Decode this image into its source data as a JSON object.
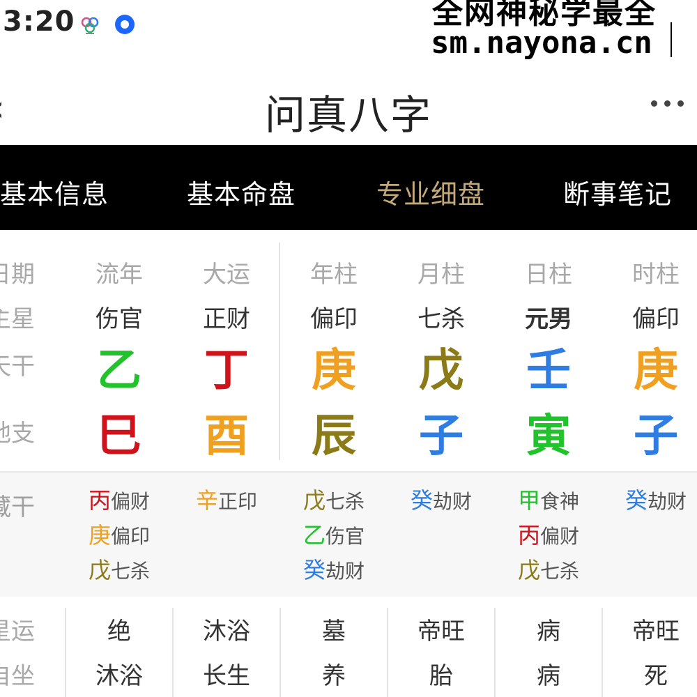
{
  "status_bar": {
    "time": "3:20"
  },
  "watermark": {
    "line1": "全网神秘学最全",
    "line2": "sm.nayona.cn"
  },
  "header": {
    "title": "问真八字"
  },
  "tabs": [
    {
      "label": "基本信息",
      "active": false
    },
    {
      "label": "基本命盘",
      "active": false
    },
    {
      "label": "专业细盘",
      "active": true
    },
    {
      "label": "断事笔记",
      "active": false
    }
  ],
  "row_labels": {
    "date": "日期",
    "main_star": "主星",
    "heavenly_stem": "天干",
    "earthly_branch": "地支",
    "hidden_stem": "藏干",
    "star_fortune": "星运",
    "self_seat": "自坐"
  },
  "columns": [
    {
      "header": "流年",
      "god": "伤官",
      "stem": "乙",
      "stem_color": "#22c22c",
      "branch": "巳",
      "branch_color": "#d0121b",
      "hidden": [
        {
          "stem": "丙",
          "color": "#d0121b",
          "god": "偏财"
        },
        {
          "stem": "庚",
          "color": "#f0a020",
          "god": "偏印"
        },
        {
          "stem": "戊",
          "color": "#8a7a18",
          "god": "七杀"
        }
      ],
      "star_fortune": "绝",
      "self_seat": "沐浴"
    },
    {
      "header": "大运",
      "god": "正财",
      "stem": "丁",
      "stem_color": "#d0121b",
      "branch": "酉",
      "branch_color": "#f0a020",
      "hidden": [
        {
          "stem": "辛",
          "color": "#f0a020",
          "god": "正印"
        }
      ],
      "star_fortune": "沐浴",
      "self_seat": "长生"
    },
    {
      "header": "年柱",
      "god": "偏印",
      "stem": "庚",
      "stem_color": "#f0a020",
      "branch": "辰",
      "branch_color": "#8a7a18",
      "hidden": [
        {
          "stem": "戊",
          "color": "#8a7a18",
          "god": "七杀"
        },
        {
          "stem": "乙",
          "color": "#22c22c",
          "god": "伤官"
        },
        {
          "stem": "癸",
          "color": "#2f7de1",
          "god": "劫财"
        }
      ],
      "star_fortune": "墓",
      "self_seat": "养"
    },
    {
      "header": "月柱",
      "god": "七杀",
      "stem": "戊",
      "stem_color": "#8a7a18",
      "branch": "子",
      "branch_color": "#2f7de1",
      "hidden": [
        {
          "stem": "癸",
          "color": "#2f7de1",
          "god": "劫财"
        }
      ],
      "star_fortune": "帝旺",
      "self_seat": "胎"
    },
    {
      "header": "日柱",
      "god": "元男",
      "god_bold": true,
      "stem": "壬",
      "stem_color": "#2f7de1",
      "branch": "寅",
      "branch_color": "#22c22c",
      "hidden": [
        {
          "stem": "甲",
          "color": "#22c22c",
          "god": "食神"
        },
        {
          "stem": "丙",
          "color": "#d0121b",
          "god": "偏财"
        },
        {
          "stem": "戊",
          "color": "#8a7a18",
          "god": "七杀"
        }
      ],
      "star_fortune": "病",
      "self_seat": "病"
    },
    {
      "header": "时柱",
      "god": "偏印",
      "stem": "庚",
      "stem_color": "#f0a020",
      "branch": "子",
      "branch_color": "#2f7de1",
      "hidden": [
        {
          "stem": "癸",
          "color": "#2f7de1",
          "god": "劫财"
        }
      ],
      "star_fortune": "帝旺",
      "self_seat": "死"
    }
  ]
}
